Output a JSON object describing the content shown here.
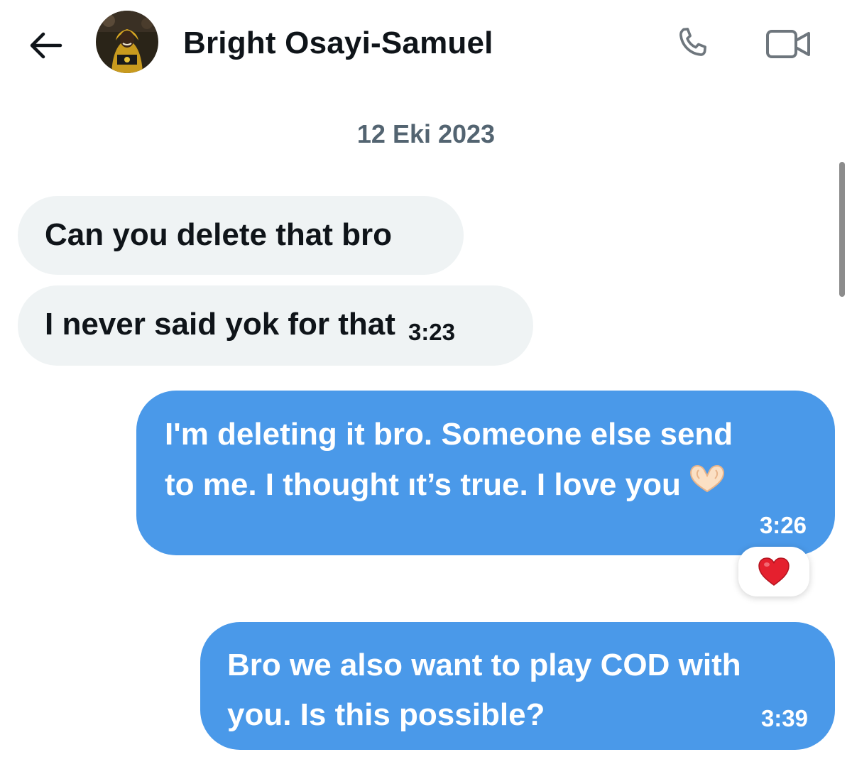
{
  "header": {
    "back_icon": "arrow-left-icon",
    "contact_name": "Bright Osayi-Samuel",
    "call_icon": "phone-icon",
    "video_icon": "video-camera-icon"
  },
  "date_divider": "12 Eki 2023",
  "messages": [
    {
      "direction": "incoming",
      "text": "Can you delete that bro",
      "time": ""
    },
    {
      "direction": "incoming",
      "text": "I never said yok for that",
      "time": "3:23"
    },
    {
      "direction": "outgoing",
      "lines": [
        "I'm deleting it bro. Someone else send",
        "to me. I thought ıt’s true.  I love you"
      ],
      "emoji": "heart-hands-emoji",
      "time": "3:26",
      "reaction": "red-heart-emoji"
    },
    {
      "direction": "outgoing",
      "lines": [
        "Bro we also want to play COD with",
        "you. Is this possible?"
      ],
      "time": "3:39"
    }
  ],
  "colors": {
    "outgoing_bubble": "#4a99e9",
    "incoming_bubble": "#eff3f4",
    "muted_text": "#536471",
    "text": "#0f1419"
  }
}
